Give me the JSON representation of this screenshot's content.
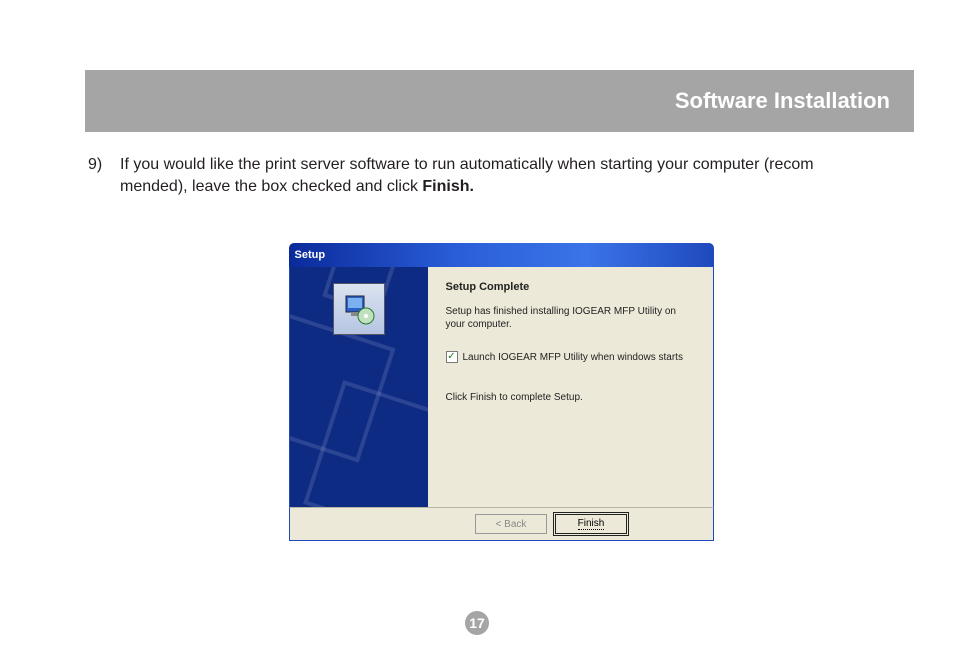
{
  "header": {
    "title": "Software Installation"
  },
  "step": {
    "number": "9)",
    "text_a": "If you would like the print server software to run automatically when starting your computer (recom",
    "text_b": "mended), leave the box checked and click ",
    "bold": "Finish."
  },
  "dialog": {
    "title": "Setup",
    "heading": "Setup Complete",
    "line1": "Setup has finished installing IOGEAR MFP Utility on your computer.",
    "checkbox_label": "Launch IOGEAR MFP Utility when windows starts",
    "checkbox_checked": "✓",
    "line2": "Click Finish to complete Setup.",
    "back": "< Back",
    "finish": "Finish"
  },
  "page_number": "17"
}
